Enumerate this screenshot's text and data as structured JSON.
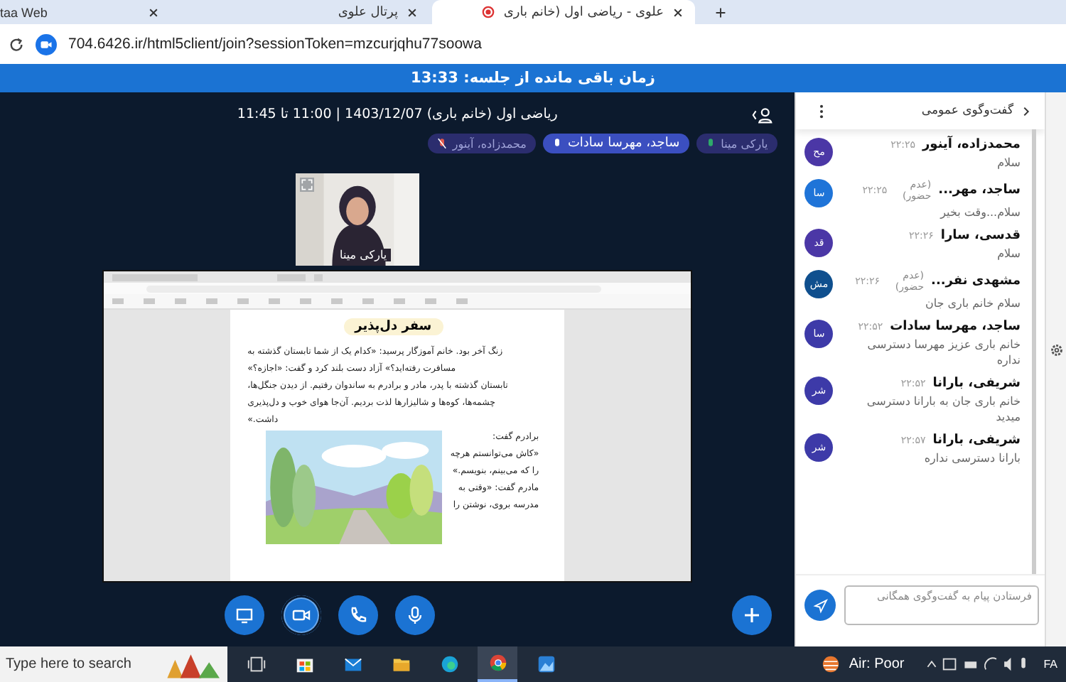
{
  "browser": {
    "tabs": [
      {
        "label": "علوی - ریاضی اول (خانم باری",
        "selected": true
      },
      {
        "label": "پرتال علوی",
        "selected": false
      },
      {
        "label": "taa Web",
        "selected": false
      }
    ],
    "address": "704.6426.ir/html5client/join?sessionToken=mzcurjqhu77soowa"
  },
  "banner": "زمان باقی مانده از جلسه: 13:33",
  "meeting": {
    "title": "ریاضی اول (خانم باری) 1403/12/07 | 11:00 تا 11:45",
    "talkers": [
      {
        "name": "یارکی مینا",
        "talking": false,
        "muted": false
      },
      {
        "name": "ساجد، مهرسا سادات",
        "talking": true,
        "muted": false
      },
      {
        "name": "محمدزاده، آینور",
        "talking": false,
        "muted": true
      }
    ],
    "video": {
      "name": "یارکی مینا"
    },
    "share": {
      "heading": "سفر دل‌پذیر",
      "lines": [
        "زنگ آخر بود. خانم آموزگار پرسید: «کدام یک از شما تابستان گذشته به",
        "مسافرت رفته‌اید؟» آزاد دست بلند کرد و گفت: «اجازه؟»",
        "تابستان گذشته با پدر، مادر و برادرم به ساندوان رفتیم. از دیدن جنگل‌ها،",
        "چشمه‌ها، کوه‌ها و شالیزارها لذت بردیم. آن‌جا هوای خوب و دل‌پذیری",
        "داشت.»"
      ],
      "side_lines": [
        "برادرم گفت:",
        "«کاش می‌توانستم هرچه",
        "را که می‌بینم، بنویسم.»",
        "مادرم گفت: «وقتی به",
        "مدرسه بروی، نوشتن را"
      ]
    },
    "controls": [
      {
        "kind": "screen",
        "on": false
      },
      {
        "kind": "camera",
        "on": true
      },
      {
        "kind": "phone",
        "on": false
      },
      {
        "kind": "mic",
        "on": false
      }
    ]
  },
  "chat": {
    "title": "گفت‌وگوی عمومی",
    "messages": [
      {
        "initials": "مح",
        "color": "#4b37a6",
        "name": "محمدزاده، آینور",
        "time": "۲۲:۲۵",
        "text": "سلام"
      },
      {
        "initials": "سا",
        "color": "#1f74d8",
        "name": "ساجد، مهر...",
        "status": "(عدم حضور)",
        "time": "۲۲:۲۵",
        "text": "سلام...وقت بخیر"
      },
      {
        "initials": "قد",
        "color": "#4b37a6",
        "name": "قدسی، سارا",
        "time": "۲۲:۲۶",
        "text": "سلام"
      },
      {
        "initials": "مش",
        "color": "#0f4f8e",
        "name": "مشهدی نفر...",
        "status": "(عدم حضور)",
        "time": "۲۲:۲۶",
        "text": "سلام خانم باری جان"
      },
      {
        "initials": "سا",
        "color": "#3d3aa8",
        "name": "ساجد، مهرسا سادات",
        "time": "۲۲:۵۲",
        "text": "خانم باری عزیز مهرسا دسترسی نداره"
      },
      {
        "initials": "شر",
        "color": "#3d3aa8",
        "name": "شریفی، بارانا",
        "time": "۲۲:۵۲",
        "text": "خانم باری جان به بارانا دسترسی میدید"
      },
      {
        "initials": "شر",
        "color": "#3d3aa8",
        "name": "شریفی، بارانا",
        "time": "۲۲:۵۷",
        "text": "بارانا دسترسی نداره"
      }
    ],
    "placeholder": "فرستادن پیام به گفت‌وگوی همگانی"
  },
  "taskbar": {
    "search_placeholder": "Type here to search",
    "apps": [
      {
        "kind": "taskview",
        "selected": false
      },
      {
        "kind": "store",
        "selected": false
      },
      {
        "kind": "mail",
        "selected": false
      },
      {
        "kind": "files",
        "selected": false
      },
      {
        "kind": "edge",
        "selected": false
      },
      {
        "kind": "chrome",
        "selected": true
      },
      {
        "kind": "photos",
        "selected": false
      }
    ],
    "air": "Air: Poor",
    "lang": "FA"
  }
}
